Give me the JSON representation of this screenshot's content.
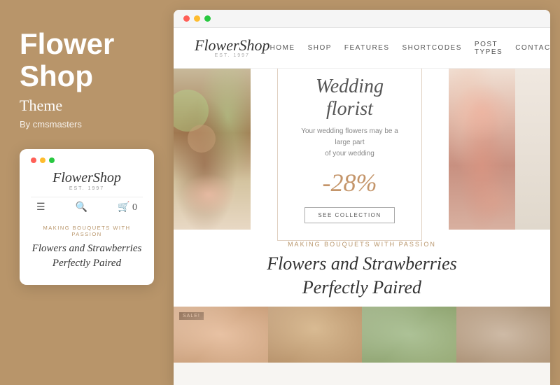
{
  "sidebar": {
    "title_line1": "Flower",
    "title_line2": "Shop",
    "subtitle": "Theme",
    "author": "By cmsmasters",
    "mobile_preview": {
      "logo": "FlowerShop",
      "logo_sub": "EST. 1997",
      "tagline": "Making Bouquets With Passion",
      "heading": "Flowers and Strawberries Perfectly Paired"
    }
  },
  "browser": {
    "dots": [
      "red",
      "yellow",
      "green"
    ]
  },
  "site": {
    "logo": "FlowerShop",
    "logo_sub": "EST. 1997",
    "nav": {
      "items": [
        "Home",
        "Shop",
        "Features",
        "Shortcodes",
        "Post Types",
        "Contacts"
      ]
    },
    "cart_count": "0",
    "hero": {
      "title": "Wedding florist",
      "description_line1": "Your wedding flowers may be a large part",
      "description_line2": "of your wedding",
      "discount": "-28%",
      "button_label": "SEE COLLECTION"
    },
    "tagline": "Making Bouquets With Passion",
    "heading_line1": "Flowers and Strawberries",
    "heading_line2": "Perfectly Paired",
    "sale_badge": "SALE!"
  }
}
